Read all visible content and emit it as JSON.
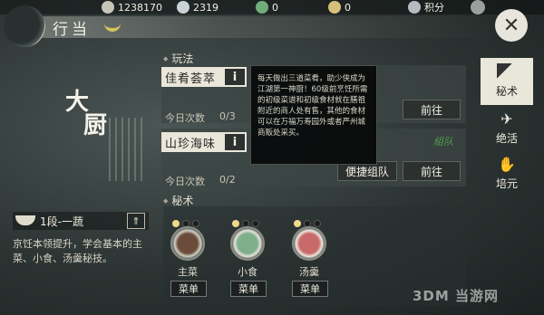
{
  "resources": [
    {
      "icon": "coin-icon",
      "value": "1238170",
      "color": "#c7c4b8"
    },
    {
      "icon": "ingot-icon",
      "value": "2319",
      "color": "#c9d2d6"
    },
    {
      "icon": "jade-icon",
      "value": "0",
      "color": "#6fae79"
    },
    {
      "icon": "pouch-icon",
      "value": "0",
      "color": "#d6c07a"
    },
    {
      "icon": "points-icon",
      "value": "积分",
      "color": "#b8bcc0"
    }
  ],
  "header": {
    "title": "行当",
    "close_label": "✕"
  },
  "left": {
    "art_title_1": "大",
    "art_title_2": "厨",
    "level": "1段-一蔬",
    "level_up_icon": "⇑",
    "description": "京饪本领提升，学会基本的主菜、小食、汤羹秘技。"
  },
  "play_section": {
    "label": "玩法",
    "cards": [
      {
        "title": "佳肴荟萃",
        "info": "i",
        "count_label": "今日次数",
        "count": "0/3",
        "go": "前往"
      },
      {
        "title": "山珍海味",
        "info": "i",
        "count_label": "今日次数",
        "count": "0/2",
        "team": "便捷组队",
        "go": "前往",
        "stamp": "組队"
      }
    ]
  },
  "tooltip": "每天做出三道菜肴，助少侠成为江湖第一神厨！60级前烹饪所需的初级菜谱和初级食材就在膳祖附近的商人处有售，其他的食材可以在万福万寿园外或者严州城商贩处采买。",
  "secret_section": {
    "label": "秘术",
    "skills": [
      {
        "name": "主菜",
        "button": "菜单",
        "dots": [
          true,
          false,
          false
        ],
        "dish_color": "#6b4b3a"
      },
      {
        "name": "小食",
        "button": "菜单",
        "dots": [
          true,
          false,
          false
        ],
        "dish_color": "#7fae8a"
      },
      {
        "name": "汤羹",
        "button": "菜单",
        "dots": [
          true,
          false,
          false
        ],
        "dish_color": "#c96a6a"
      }
    ]
  },
  "right_tabs": [
    {
      "label": "秘术",
      "icon": "book-icon",
      "active": true
    },
    {
      "label": "绝活",
      "icon": "plane-icon",
      "active": false
    },
    {
      "label": "培元",
      "icon": "hand-icon",
      "active": false
    }
  ],
  "watermark": "3DM 当游网"
}
